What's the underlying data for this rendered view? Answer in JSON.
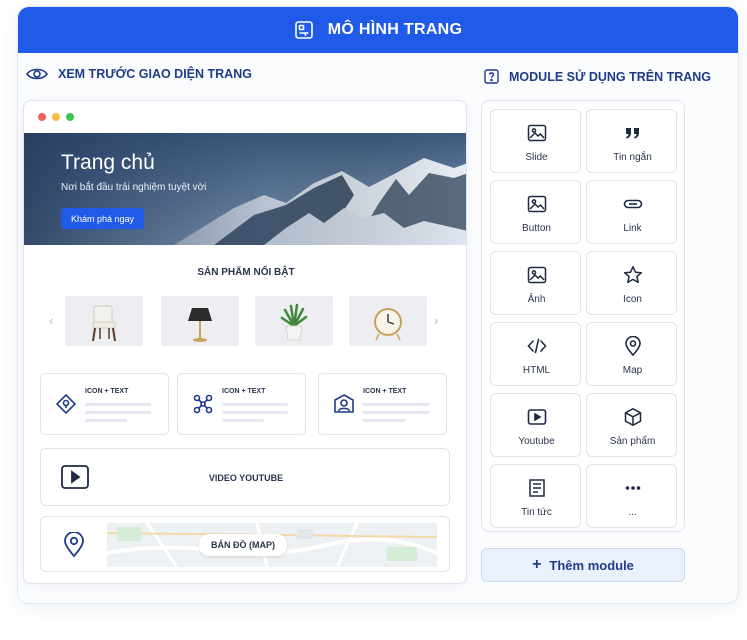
{
  "header": {
    "title": "MÔ HÌNH TRANG",
    "icon": "layout-icon"
  },
  "preview_section": {
    "title": "XEM TRƯỚC GIAO DIỆN TRANG",
    "icon": "eye-icon",
    "hero": {
      "title": "Trang chủ",
      "subtitle": "Nơi bắt đầu trải nghiệm tuyệt vời",
      "button": "Khám phá ngay"
    },
    "featured_title": "SẢN PHẨM NỔI BẬT",
    "products": [
      "chair",
      "lamp",
      "plant",
      "clock"
    ],
    "icon_text_cards": [
      {
        "label": "ICON + TEXT",
        "icon": "location-diamond-icon"
      },
      {
        "label": "ICON + TEXT",
        "icon": "network-icon"
      },
      {
        "label": "ICON + TEXT",
        "icon": "user-frame-icon"
      }
    ],
    "video_label": "VIDEO YOUTUBE",
    "map_label": "BẢN ĐỒ (MAP)"
  },
  "modules_section": {
    "title": "MODULE SỬ DỤNG TRÊN TRANG",
    "icon": "question-box-icon",
    "items": [
      {
        "label": "Slide",
        "icon": "image-icon"
      },
      {
        "label": "Tin ngắn",
        "icon": "quote-icon"
      },
      {
        "label": "Button",
        "icon": "image-icon"
      },
      {
        "label": "Link",
        "icon": "link-icon"
      },
      {
        "label": "Ảnh",
        "icon": "image-icon"
      },
      {
        "label": "Icon",
        "icon": "star-icon"
      },
      {
        "label": "HTML",
        "icon": "code-icon"
      },
      {
        "label": "Map",
        "icon": "map-pin-icon"
      },
      {
        "label": "Youtube",
        "icon": "play-icon"
      },
      {
        "label": "Sản phẩm",
        "icon": "box-icon"
      },
      {
        "label": "Tin tức",
        "icon": "news-icon"
      },
      {
        "label": "...",
        "icon": "more-icon"
      }
    ],
    "add_button": "Thêm module"
  },
  "colors": {
    "primary": "#1f5be8",
    "title_text": "#1f3c8a",
    "border": "#dde4ef"
  }
}
